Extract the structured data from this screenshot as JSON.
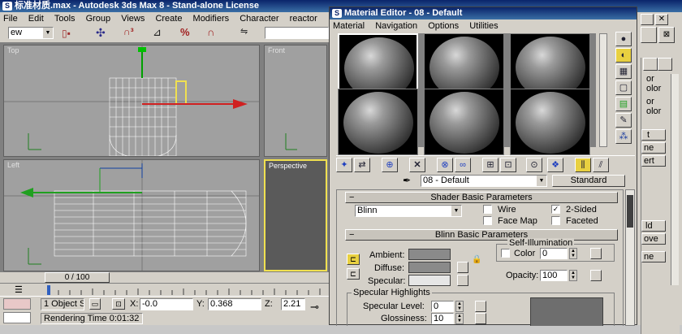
{
  "main_window": {
    "title": "标准材质.max - Autodesk 3ds Max 8 - Stand-alone License",
    "menu": [
      "File",
      "Edit",
      "Tools",
      "Group",
      "Views",
      "Create",
      "Modifiers",
      "Character",
      "reactor"
    ],
    "selection_dropdown": "ew",
    "viewports": {
      "top": "Top",
      "front": "Front",
      "left": "Left",
      "perspective": "Perspective"
    },
    "time_slider": "0 / 100",
    "status": {
      "objects_selected": "1 Object S",
      "x_label": "X:",
      "x_value": "-0.0",
      "y_label": "Y:",
      "y_value": "0.368",
      "z_label": "Z:",
      "z_value": "2.21",
      "rendering_time": "Rendering Time  0:01:32"
    },
    "right_panel": {
      "labels": [
        "or",
        "olor",
        "or",
        "olor",
        "t",
        "ne",
        "ert",
        "ld",
        "ove",
        "ne"
      ]
    }
  },
  "material_editor": {
    "title": "Material Editor - 08 - Default",
    "menu": [
      "Material",
      "Navigation",
      "Options",
      "Utilities"
    ],
    "material_name": "08 - Default",
    "material_type": "Standard",
    "shader_rollout": {
      "title": "Shader Basic Parameters",
      "shader": "Blinn",
      "wire": "Wire",
      "two_sided": "2-Sided",
      "face_map": "Face Map",
      "faceted": "Faceted",
      "two_sided_checked": "✓"
    },
    "blinn_rollout": {
      "title": "Blinn Basic Parameters",
      "self_illum_title": "Self-Illumination",
      "color_label": "Color",
      "color_value": "0",
      "ambient": "Ambient:",
      "diffuse": "Diffuse:",
      "specular": "Specular:",
      "opacity_label": "Opacity:",
      "opacity_value": "100"
    },
    "specular_highlights": {
      "title": "Specular Highlights",
      "level_label": "Specular Level:",
      "level_value": "0",
      "gloss_label": "Glossiness:",
      "gloss_value": "10"
    }
  },
  "colors": {
    "title_bar": "#0a246a",
    "ui_face": "#d4d0c8",
    "viewport_bg": "#a0a0a0",
    "wire": "#ffffff",
    "active_border": "#f0e050"
  }
}
